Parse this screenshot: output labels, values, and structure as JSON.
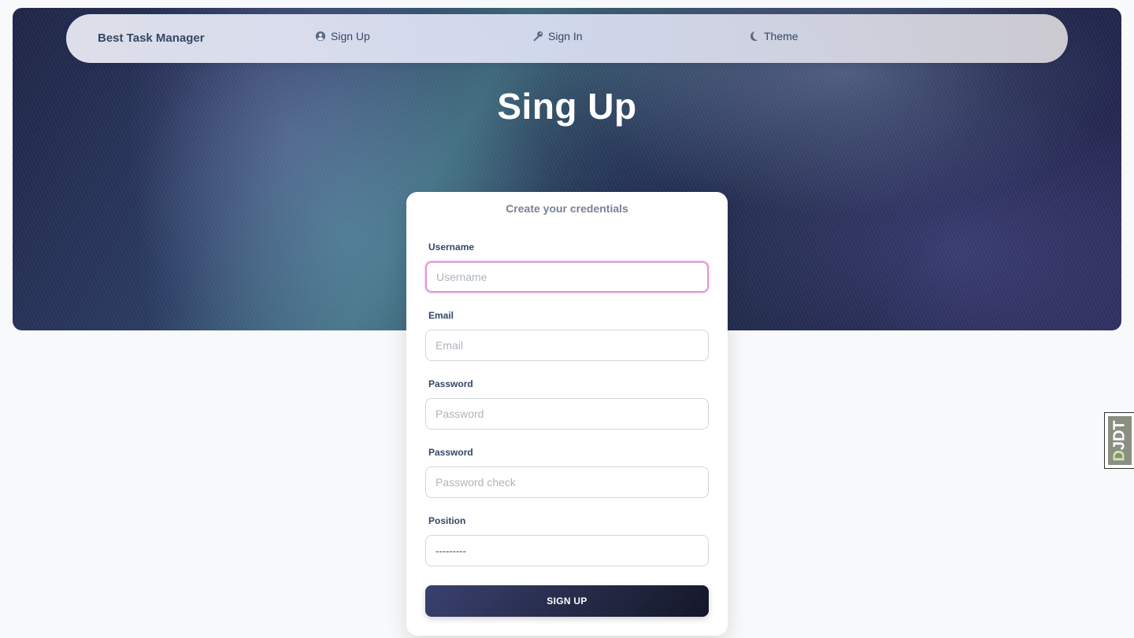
{
  "navbar": {
    "brand": "Best Task Manager",
    "items": [
      {
        "label": "Sign Up",
        "icon": "user-circle-icon"
      },
      {
        "label": "Sign In",
        "icon": "key-icon"
      },
      {
        "label": "Theme",
        "icon": "moon-icon"
      }
    ]
  },
  "hero": {
    "title": "Sing Up"
  },
  "form": {
    "header": "Create your credentials",
    "fields": [
      {
        "label": "Username",
        "placeholder": "Username",
        "focused": true
      },
      {
        "label": "Email",
        "placeholder": "Email"
      },
      {
        "label": "Password",
        "placeholder": "Password"
      },
      {
        "label": "Password",
        "placeholder": "Password check"
      }
    ],
    "position": {
      "label": "Position",
      "selected": "---------"
    },
    "submit_label": "SIGN UP"
  },
  "debug_toolbar": {
    "label_d": "D",
    "label_rest": "JDT"
  },
  "colors": {
    "primary_text": "#344767",
    "muted_text": "#7b809a",
    "focus_border": "#e293d3",
    "button_gradient_start": "#3a416f",
    "button_gradient_end": "#141727"
  }
}
